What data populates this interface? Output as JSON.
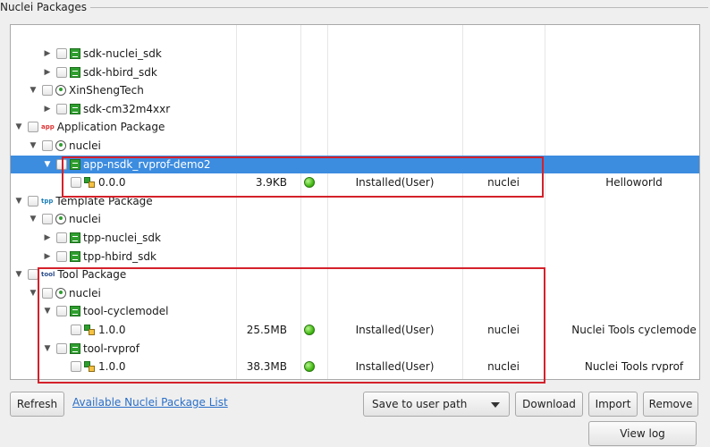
{
  "group_title": "Nuclei Packages",
  "rows": [
    {
      "indent": 2,
      "arrow": "right",
      "icon": "sdk",
      "label": "sdk-nuclei_sdk"
    },
    {
      "indent": 2,
      "arrow": "right",
      "icon": "sdk",
      "label": "sdk-hbird_sdk"
    },
    {
      "indent": 1,
      "arrow": "down",
      "icon": "user",
      "label": "XinShengTech"
    },
    {
      "indent": 2,
      "arrow": "right",
      "icon": "sdk",
      "label": "sdk-cm32m4xxr"
    },
    {
      "indent": 0,
      "arrow": "down",
      "icon": "app",
      "icon_text": "app",
      "label": "Application Package"
    },
    {
      "indent": 1,
      "arrow": "down",
      "icon": "user",
      "label": "nuclei"
    },
    {
      "indent": 2,
      "arrow": "down",
      "icon": "sdk",
      "label": "app-nsdk_rvprof-demo2",
      "selected": true
    },
    {
      "indent": 3,
      "arrow": "",
      "icon": "ver",
      "label": "0.0.0",
      "size": "3.9KB",
      "status_dot": true,
      "status": "Installed(User)",
      "vendor": "nuclei",
      "desc": "Helloworld"
    },
    {
      "indent": 0,
      "arrow": "down",
      "icon": "tpp",
      "icon_text": "tpp",
      "label": "Template Package"
    },
    {
      "indent": 1,
      "arrow": "down",
      "icon": "user",
      "label": "nuclei"
    },
    {
      "indent": 2,
      "arrow": "right",
      "icon": "sdk",
      "label": "tpp-nuclei_sdk"
    },
    {
      "indent": 2,
      "arrow": "right",
      "icon": "sdk",
      "label": "tpp-hbird_sdk"
    },
    {
      "indent": 0,
      "arrow": "down",
      "icon": "tool",
      "icon_text": "tool",
      "label": "Tool Package"
    },
    {
      "indent": 1,
      "arrow": "down",
      "icon": "user",
      "label": "nuclei"
    },
    {
      "indent": 2,
      "arrow": "down",
      "icon": "sdk",
      "label": "tool-cyclemodel"
    },
    {
      "indent": 3,
      "arrow": "",
      "icon": "ver",
      "label": "1.0.0",
      "size": "25.5MB",
      "status_dot": true,
      "status": "Installed(User)",
      "vendor": "nuclei",
      "desc": "Nuclei Tools cyclemode"
    },
    {
      "indent": 2,
      "arrow": "down",
      "icon": "sdk",
      "label": "tool-rvprof"
    },
    {
      "indent": 3,
      "arrow": "",
      "icon": "ver",
      "label": "1.0.0",
      "size": "38.3MB",
      "status_dot": true,
      "status": "Installed(User)",
      "vendor": "nuclei",
      "desc": "Nuclei Tools rvprof"
    }
  ],
  "buttons": {
    "refresh": "Refresh",
    "link": "Available Nuclei Package List",
    "save_path": "Save to user path",
    "download": "Download",
    "import": "Import",
    "remove": "Remove",
    "view_log": "View log"
  },
  "colors": {
    "selection": "#3c8ce0",
    "highlight": "#d4212b",
    "link": "#2a6fc9"
  }
}
